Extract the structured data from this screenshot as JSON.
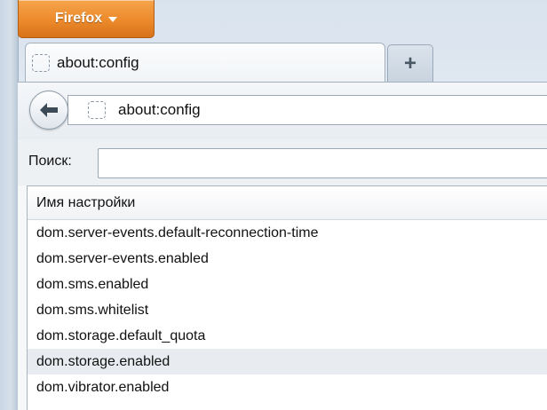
{
  "firefox_menu": {
    "label": "Firefox"
  },
  "tabs": [
    {
      "label": "about:config",
      "favicon": "blank-page-icon"
    }
  ],
  "new_tab": {
    "label": "+"
  },
  "navbar": {
    "back_icon": "back-arrow-icon",
    "url": "about:config"
  },
  "search": {
    "label": "Поиск:",
    "value": ""
  },
  "prefs_table": {
    "column_header": "Имя настройки",
    "rows": [
      "dom.server-events.default-reconnection-time",
      "dom.server-events.enabled",
      "dom.sms.enabled",
      "dom.sms.whitelist",
      "dom.storage.default_quota",
      "dom.storage.enabled",
      "dom.vibrator.enabled"
    ],
    "selected_index": 5
  },
  "colors": {
    "firefox_button": "#ec8a2b",
    "selected_row": "#e8ecf0"
  }
}
